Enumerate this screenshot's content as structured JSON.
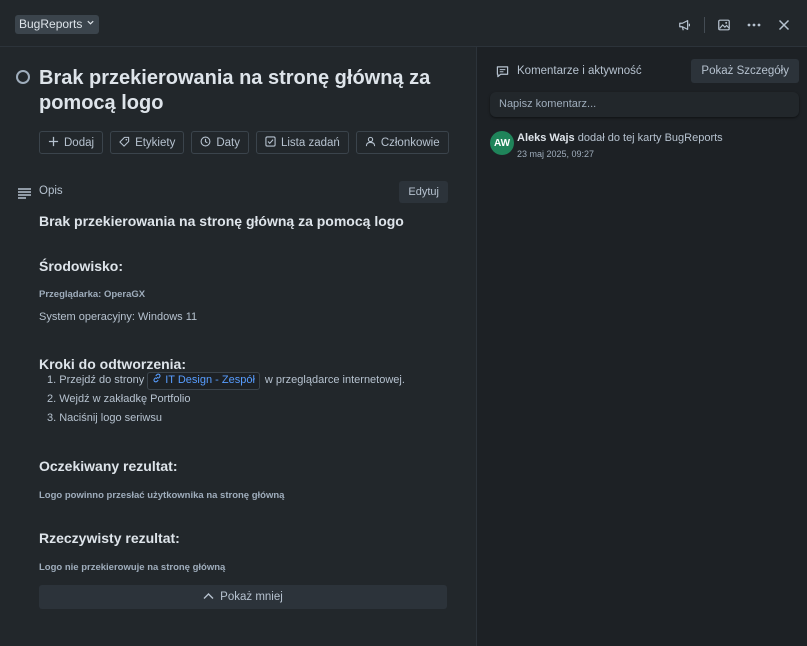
{
  "topbar": {
    "board_name": "BugReports",
    "icons": [
      "chevron-down-icon",
      "megaphone-icon",
      "image-icon",
      "more-icon",
      "close-icon"
    ]
  },
  "card": {
    "title": "Brak przekierowania na stronę główną za pomocą logo",
    "actions": [
      {
        "label": "Dodaj",
        "icon": "plus-icon"
      },
      {
        "label": "Etykiety",
        "icon": "label-icon"
      },
      {
        "label": "Daty",
        "icon": "clock-icon"
      },
      {
        "label": "Lista zadań",
        "icon": "checklist-icon"
      },
      {
        "label": "Członkowie",
        "icon": "person-icon"
      }
    ],
    "description_label": "Opis",
    "edit_label": "Edytuj",
    "description": {
      "heading": "Brak przekierowania na stronę główną za pomocą logo",
      "env_heading": "Środowisko:",
      "browser": "Przeglądarka: OperaGX",
      "os": "System operacyjny: Windows 11",
      "steps_heading": "Kroki do odtworzenia:",
      "step1_before": "Przejdź do strony",
      "step1_link": "IT Design - Zespół",
      "step1_after": "w przeglądarce internetowej.",
      "step2": "Wejdź w zakładkę Portfolio",
      "step3": "Naciśnij logo seriwsu",
      "expected_heading": "Oczekiwany rezultat:",
      "expected": "Logo powinno przesłać użytkownika na stronę główną",
      "actual_heading": "Rzeczywisty rezultat:",
      "actual": "Logo nie przekierowuje na stronę główną"
    },
    "show_less": "Pokaż mniej"
  },
  "sidebar": {
    "heading": "Komentarze i aktywność",
    "details_button": "Pokaż Szczegóły",
    "comment_placeholder": "Napisz komentarz...",
    "activity": {
      "avatar_initials": "AW",
      "user": "Aleks Wajs",
      "action": "dodał do tej karty BugReports",
      "timestamp": "23 maj 2025, 09:27"
    }
  },
  "colors": {
    "accent_link": "#579dff",
    "avatar_bg": "#1f845a",
    "background": "#1d2125",
    "panel": "#22272b"
  }
}
